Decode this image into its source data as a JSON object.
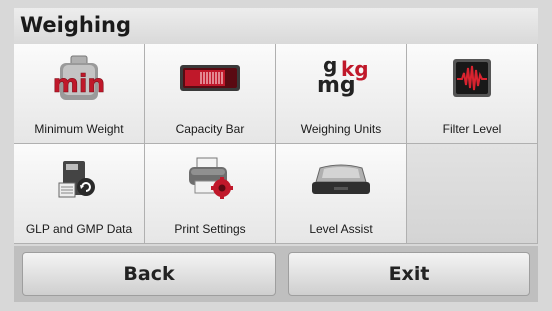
{
  "header": {
    "title": "Weighing"
  },
  "tiles": [
    {
      "label": "Minimum Weight",
      "icon": "min-weight-icon"
    },
    {
      "label": "Capacity Bar",
      "icon": "capacity-bar-icon"
    },
    {
      "label": "Weighing Units",
      "icon": "weighing-units-icon",
      "icon_text": {
        "g": "g",
        "kg": "kg",
        "mg": "mg"
      }
    },
    {
      "label": "Filter Level",
      "icon": "filter-level-icon"
    },
    {
      "label": "GLP and GMP Data",
      "icon": "glp-data-icon"
    },
    {
      "label": "Print Settings",
      "icon": "printer-settings-icon"
    },
    {
      "label": "Level Assist",
      "icon": "level-assist-icon"
    }
  ],
  "footer": {
    "back_label": "Back",
    "exit_label": "Exit"
  },
  "colors": {
    "accent_red": "#c0182a",
    "header_bg": "#e4e4e4",
    "tile_bg": "#f2f2f2"
  }
}
